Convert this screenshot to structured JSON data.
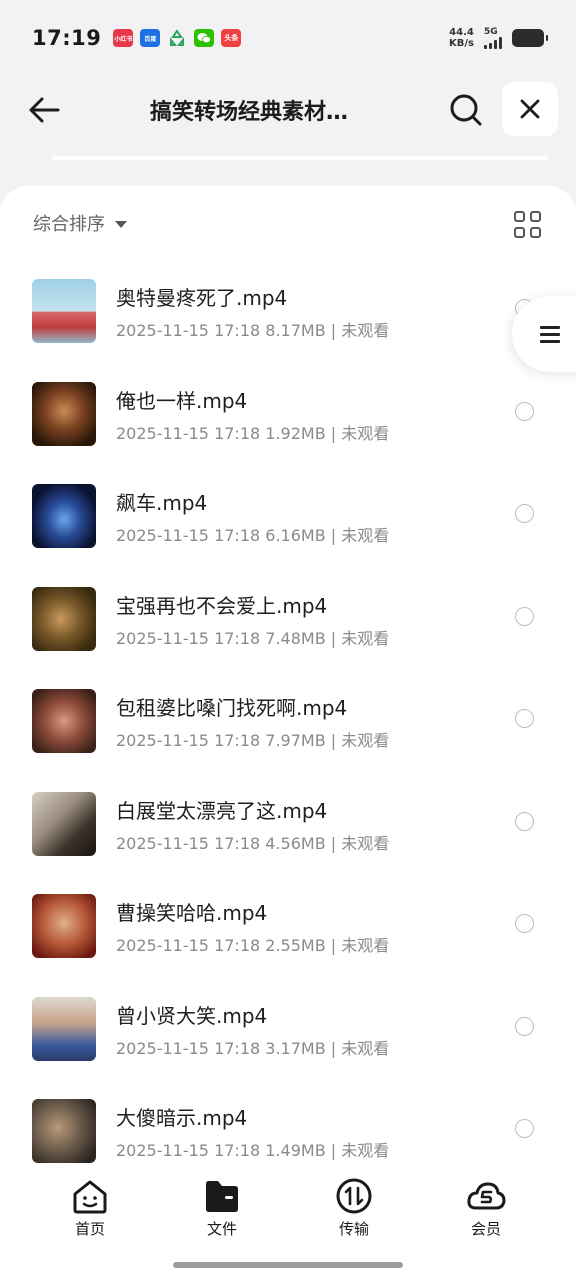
{
  "status_bar": {
    "time": "17:19",
    "net_speed_value": "44.4",
    "net_speed_unit": "KB/s",
    "network": "5G",
    "notification_icons": [
      "xiaohongshu-icon",
      "baidu-netdisk-icon",
      "recycle-icon",
      "wechat-icon",
      "toutiao-icon"
    ],
    "notif_labels": [
      "小红书",
      "百度",
      "",
      "",
      "头条"
    ]
  },
  "header": {
    "title": "搞笑转场经典素材…"
  },
  "toolbar": {
    "sort_label": "综合排序"
  },
  "files": [
    {
      "name": "奥特曼疼死了.mp4",
      "meta": "2025-11-15 17:18  8.17MB | 未观看"
    },
    {
      "name": "俺也一样.mp4",
      "meta": "2025-11-15 17:18  1.92MB | 未观看"
    },
    {
      "name": "飙车.mp4",
      "meta": "2025-11-15 17:18  6.16MB | 未观看"
    },
    {
      "name": "宝强再也不会爱上.mp4",
      "meta": "2025-11-15 17:18  7.48MB | 未观看"
    },
    {
      "name": "包租婆比嗓门找死啊.mp4",
      "meta": "2025-11-15 17:18  7.97MB | 未观看"
    },
    {
      "name": "白展堂太漂亮了这.mp4",
      "meta": "2025-11-15 17:18  4.56MB | 未观看"
    },
    {
      "name": "曹操笑哈哈.mp4",
      "meta": "2025-11-15 17:18  2.55MB | 未观看"
    },
    {
      "name": "曾小贤大笑.mp4",
      "meta": "2025-11-15 17:18  3.17MB | 未观看"
    },
    {
      "name": "大傻暗示.mp4",
      "meta": "2025-11-15 17:18  1.49MB | 未观看"
    }
  ],
  "bottom_nav": [
    {
      "label": "首页",
      "icon": "home-face-icon"
    },
    {
      "label": "文件",
      "icon": "folder-icon"
    },
    {
      "label": "传输",
      "icon": "transfer-icon"
    },
    {
      "label": "会员",
      "icon": "cloud-vip-icon"
    }
  ],
  "colors": {
    "background": "#f2f2f4",
    "panel": "#ffffff",
    "text_primary": "#1f1f1f",
    "text_secondary": "#8a8a8a"
  }
}
